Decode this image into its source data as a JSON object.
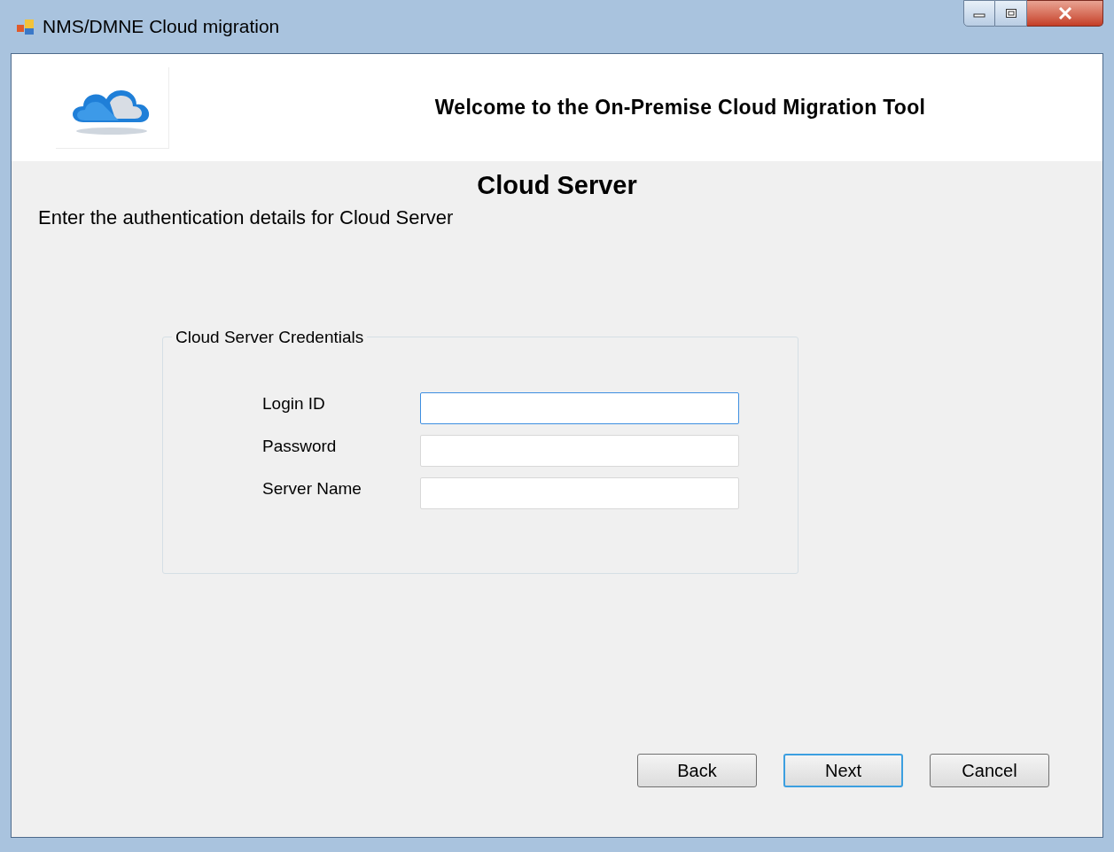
{
  "window": {
    "title": "NMS/DMNE Cloud migration"
  },
  "header": {
    "title": "Welcome to the On-Premise Cloud Migration Tool"
  },
  "page": {
    "heading": "Cloud Server",
    "instruction": "Enter the authentication details for Cloud Server"
  },
  "group": {
    "title": "Cloud Server Credentials",
    "fields": [
      {
        "label": "Login ID",
        "focused": true
      },
      {
        "label": "Password",
        "focused": false
      },
      {
        "label": "Server Name",
        "focused": false
      }
    ]
  },
  "buttons": [
    {
      "label": "Back",
      "default": false
    },
    {
      "label": "Next",
      "default": true
    },
    {
      "label": "Cancel",
      "default": false
    }
  ]
}
